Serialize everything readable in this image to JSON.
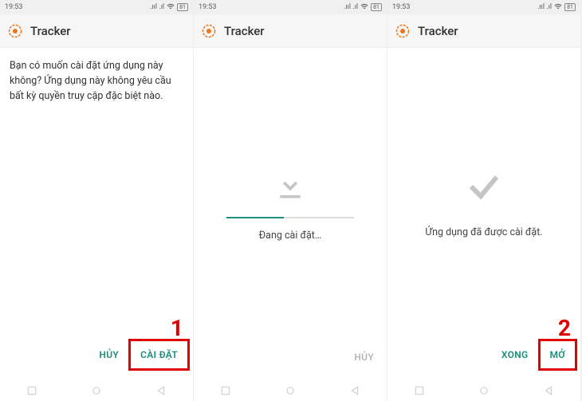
{
  "statusbar": {
    "time": "19:53",
    "battery": "81"
  },
  "app": {
    "title": "Tracker"
  },
  "screen1": {
    "prompt": "Bạn có muốn cài đặt ứng dụng này không? Ứng dụng này không yêu cầu bất kỳ quyền truy cập đặc biệt nào.",
    "btn_cancel": "HỦY",
    "btn_install": "CÀI ĐẶT",
    "anno": "1"
  },
  "screen2": {
    "caption": "Đang cài đặt…",
    "btn_cancel": "HỦY"
  },
  "screen3": {
    "caption": "Ứng dụng đã được cài đặt.",
    "btn_done": "XONG",
    "btn_open": "MỞ",
    "anno": "2"
  },
  "colors": {
    "accent": "#1b8e7f",
    "anno": "#e00000"
  }
}
